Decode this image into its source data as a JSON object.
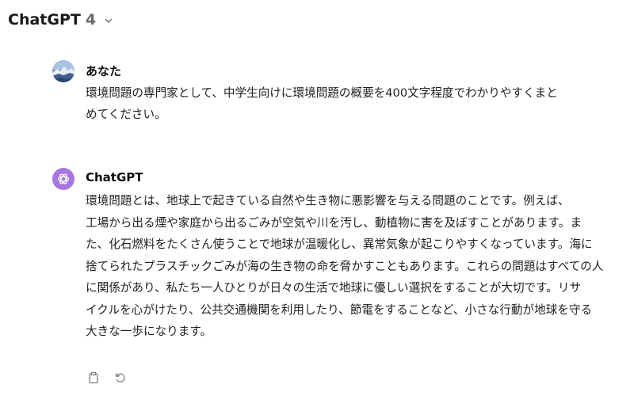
{
  "header": {
    "model_name": "ChatGPT",
    "model_version": "4",
    "icon": "chevron-down-icon"
  },
  "messages": [
    {
      "role": "user",
      "author": "あなた",
      "avatar_icon": "user-avatar",
      "lines": [
        "環境問題の専門家として、中学生向けに環境問題の概要を400文字程度でわかりやすくまと",
        "めてください。"
      ]
    },
    {
      "role": "assistant",
      "author": "ChatGPT",
      "avatar_icon": "chatgpt-logo-icon",
      "avatar_color": "#a876e0",
      "lines": [
        "環境問題とは、地球上で起きている自然や生き物に悪影響を与える問題のことです。例えば、",
        "工場から出る煙や家庭から出るごみが空気や川を汚し、動植物に害を及ぼすことがあります。ま",
        "た、化石燃料をたくさん使うことで地球が温暖化し、異常気象が起こりやすくなっています。海に",
        "捨てられたプラスチックごみが海の生き物の命を脅かすこともあります。これらの問題はすべての人",
        "に関係があり、私たち一人ひとりが日々の生活で地球に優しい選択をすることが大切です。リサ",
        "イクルを心がけたり、公共交通機関を利用したり、節電をすることなど、小さな行動が地球を守る",
        "大きな一歩になります。"
      ],
      "actions": [
        {
          "name": "copy-button",
          "icon": "clipboard-icon"
        },
        {
          "name": "regenerate-button",
          "icon": "refresh-icon"
        }
      ]
    }
  ]
}
